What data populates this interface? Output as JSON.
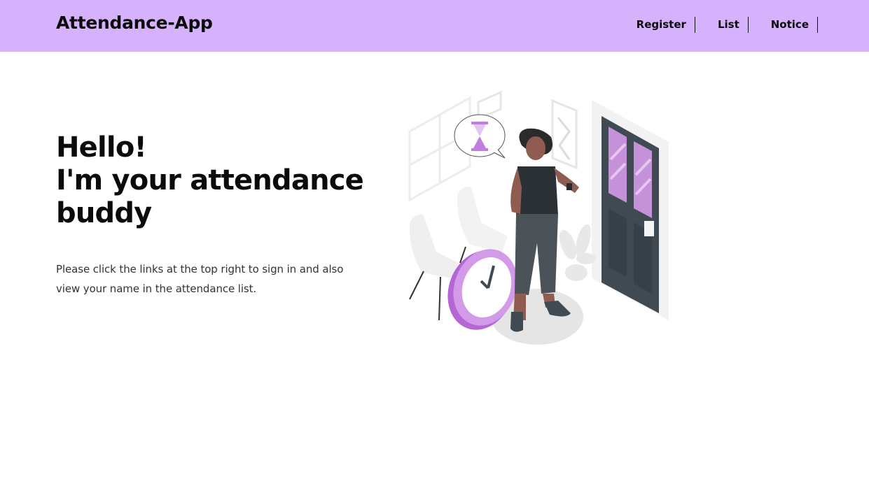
{
  "navbar": {
    "brand": "Attendance-App",
    "links": [
      {
        "label": "Register"
      },
      {
        "label": "List"
      },
      {
        "label": "Notice"
      }
    ],
    "background": "#d7b2fc"
  },
  "hero": {
    "title_line1": "Hello!",
    "title_line2": "I'm your attendance",
    "title_line3": "buddy",
    "text": "Please click the links at the top right to sign in and also view your name in the attendance list."
  },
  "illustration": {
    "icon": "person-checking-watch-illustration",
    "accent": "#c07fe0"
  }
}
